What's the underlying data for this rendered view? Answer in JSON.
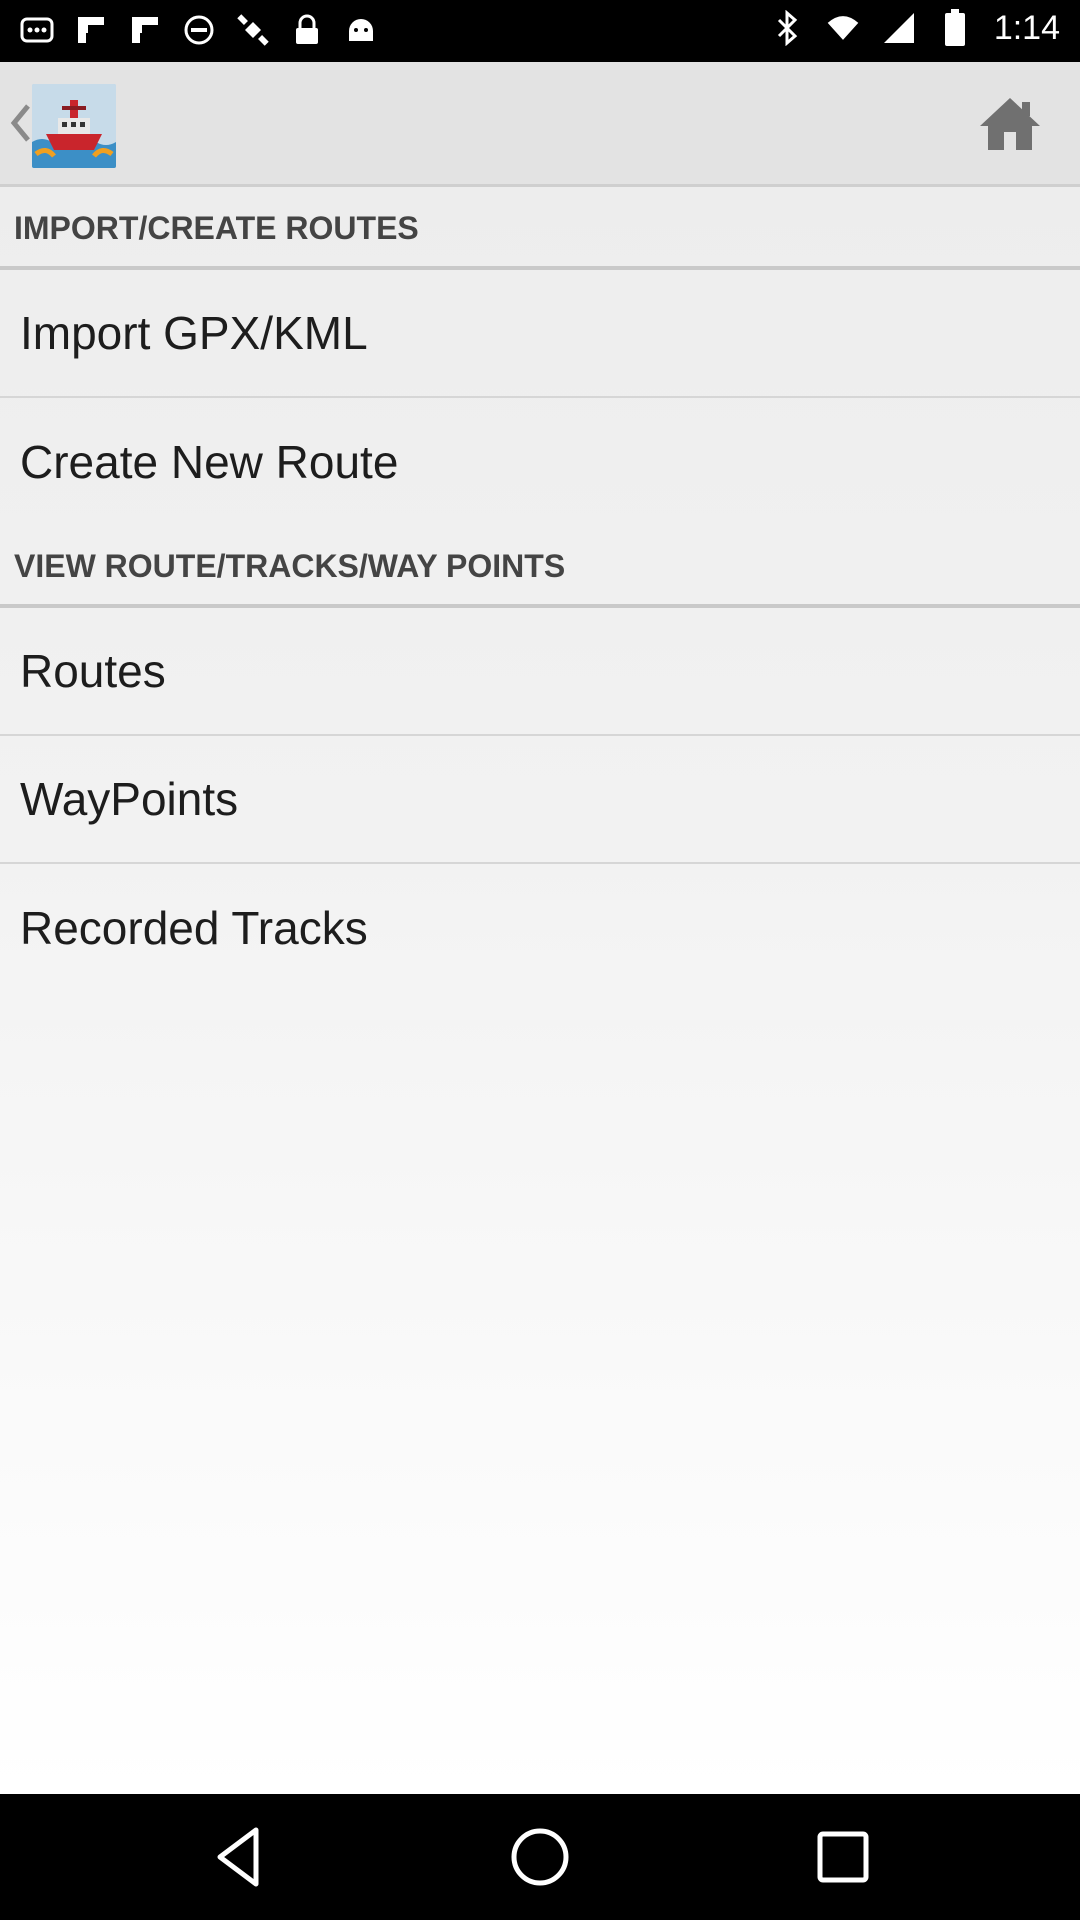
{
  "status_bar": {
    "time": "1:14",
    "icons": [
      "notification-icon",
      "flipboard-icon",
      "flipboard-icon",
      "circle-icon",
      "satellite-fake-icon",
      "lock-icon",
      "android-icon",
      "bluetooth-icon",
      "wifi-icon",
      "signal-icon",
      "battery-icon"
    ]
  },
  "action_bar": {
    "back_icon": "chevron-left-icon",
    "logo_icon": "ship-logo-icon",
    "home_icon": "home-icon"
  },
  "sections": [
    {
      "header": "IMPORT/CREATE ROUTES",
      "items": [
        "Import GPX/KML",
        "Create New Route"
      ]
    },
    {
      "header": "VIEW ROUTE/TRACKS/WAY POINTS",
      "items": [
        "Routes",
        "WayPoints",
        "Recorded Tracks"
      ]
    }
  ],
  "nav_bar": {
    "icons": [
      "back-triangle-icon",
      "home-circle-icon",
      "recents-square-icon"
    ]
  },
  "colors": {
    "header_text": "#444444",
    "item_text": "#1d1d1d",
    "action_bar": "#e3e3e3"
  }
}
